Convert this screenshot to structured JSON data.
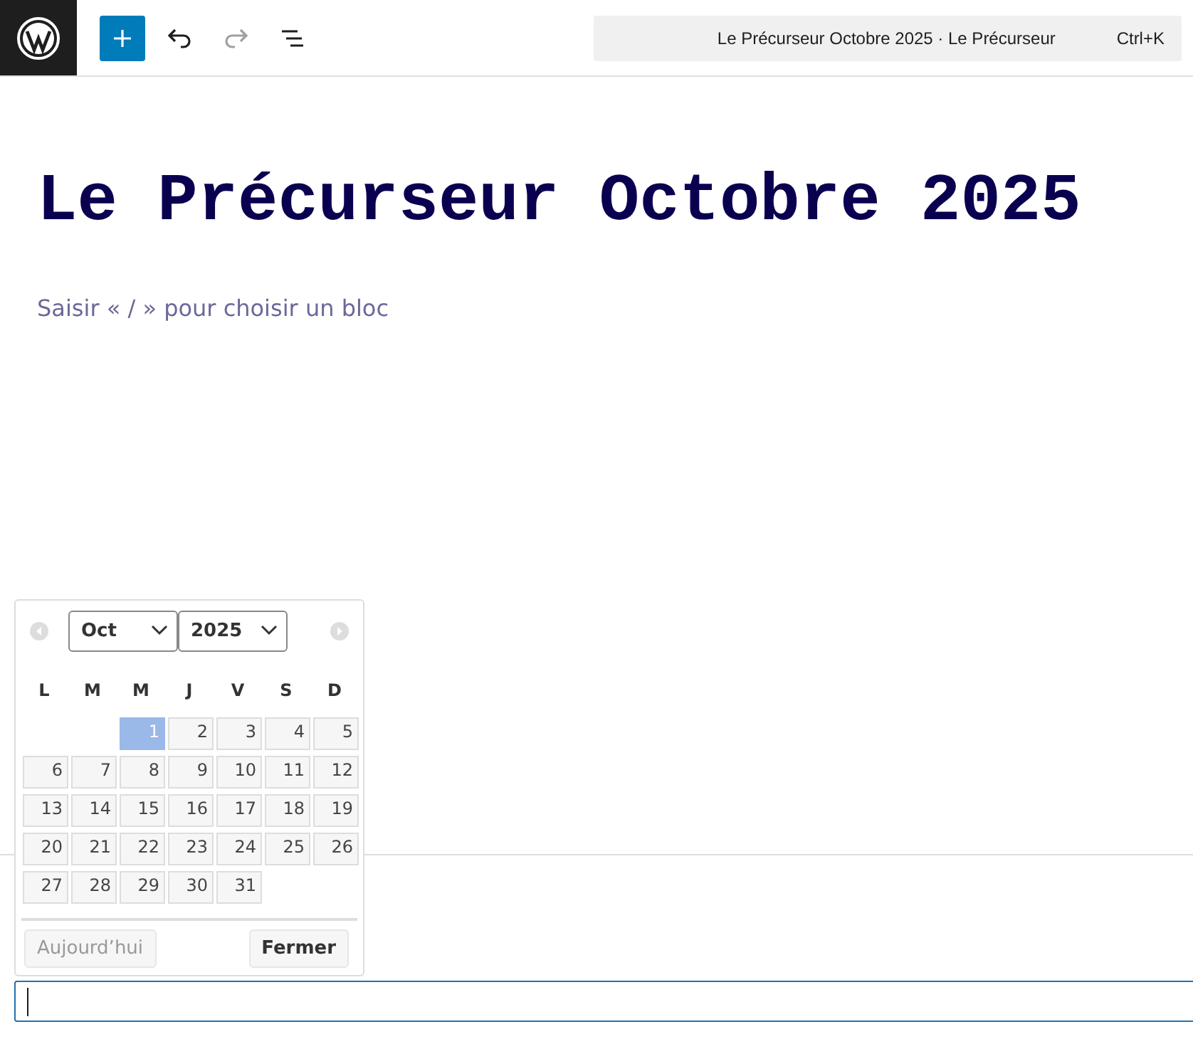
{
  "toolbar": {
    "command_bar": {
      "text": "Le Précurseur Octobre 2025 · Le Précurseur",
      "shortcut": "Ctrl+K"
    },
    "redo_disabled": true
  },
  "post": {
    "title": "Le Précurseur Octobre 2025",
    "placeholder": "Saisir « / » pour choisir un bloc"
  },
  "datepicker": {
    "month": "Oct",
    "year": "2025",
    "weekdays": [
      "L",
      "M",
      "M",
      "J",
      "V",
      "S",
      "D"
    ],
    "weeks": [
      [
        {
          "kind": "empty"
        },
        {
          "kind": "empty"
        },
        {
          "day": "1",
          "selected": true
        },
        {
          "day": "2",
          "selected": false
        },
        {
          "day": "3",
          "selected": false
        },
        {
          "day": "4",
          "selected": false
        },
        {
          "day": "5",
          "selected": false
        }
      ],
      [
        {
          "day": "6",
          "selected": false
        },
        {
          "day": "7",
          "selected": false
        },
        {
          "day": "8",
          "selected": false
        },
        {
          "day": "9",
          "selected": false
        },
        {
          "day": "10",
          "selected": false
        },
        {
          "day": "11",
          "selected": false
        },
        {
          "day": "12",
          "selected": false
        }
      ],
      [
        {
          "day": "13",
          "selected": false
        },
        {
          "day": "14",
          "selected": false
        },
        {
          "day": "15",
          "selected": false
        },
        {
          "day": "16",
          "selected": false
        },
        {
          "day": "17",
          "selected": false
        },
        {
          "day": "18",
          "selected": false
        },
        {
          "day": "19",
          "selected": false
        }
      ],
      [
        {
          "day": "20",
          "selected": false
        },
        {
          "day": "21",
          "selected": false
        },
        {
          "day": "22",
          "selected": false
        },
        {
          "day": "23",
          "selected": false
        },
        {
          "day": "24",
          "selected": false
        },
        {
          "day": "25",
          "selected": false
        },
        {
          "day": "26",
          "selected": false
        }
      ],
      [
        {
          "day": "27",
          "selected": false
        },
        {
          "day": "28",
          "selected": false
        },
        {
          "day": "29",
          "selected": false
        },
        {
          "day": "30",
          "selected": false
        },
        {
          "day": "31",
          "selected": false
        },
        {
          "kind": "empty"
        },
        {
          "kind": "empty"
        }
      ]
    ],
    "today_button": "Aujourd’hui",
    "close_button": "Fermer"
  }
}
